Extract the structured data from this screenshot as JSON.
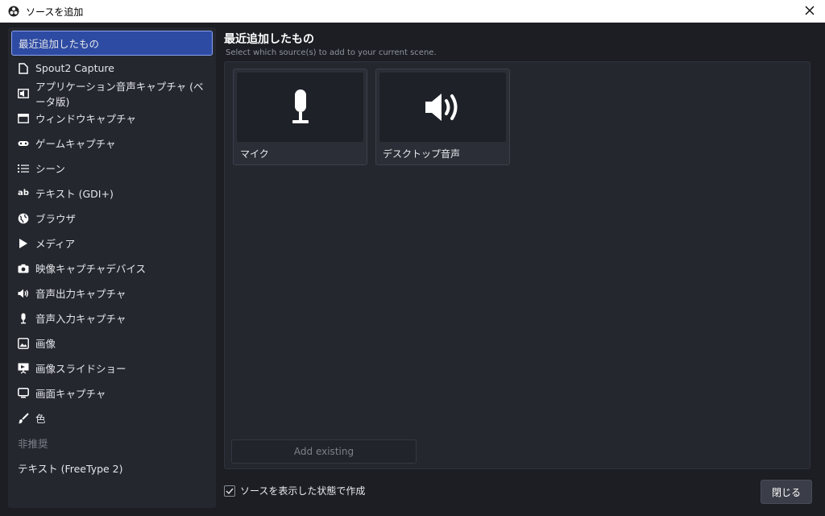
{
  "window": {
    "title": "ソースを追加"
  },
  "sidebar": {
    "items": [
      {
        "label": "最近追加したもの",
        "icon": ""
      },
      {
        "label": "Spout2 Capture",
        "icon": "file-icon"
      },
      {
        "label": "アプリケーション音声キャプチャ (ベータ版)",
        "icon": "app-audio-icon"
      },
      {
        "label": "ウィンドウキャプチャ",
        "icon": "window-icon"
      },
      {
        "label": "ゲームキャプチャ",
        "icon": "gamepad-icon"
      },
      {
        "label": "シーン",
        "icon": "list-icon"
      },
      {
        "label": "テキスト (GDI+)",
        "icon": "text-icon",
        "icon_text": "ab"
      },
      {
        "label": "ブラウザ",
        "icon": "globe-icon"
      },
      {
        "label": "メディア",
        "icon": "play-icon"
      },
      {
        "label": "映像キャプチャデバイス",
        "icon": "camera-icon"
      },
      {
        "label": "音声出力キャプチャ",
        "icon": "speaker-icon"
      },
      {
        "label": "音声入力キャプチャ",
        "icon": "microphone-icon"
      },
      {
        "label": "画像",
        "icon": "image-icon"
      },
      {
        "label": "画像スライドショー",
        "icon": "slideshow-icon"
      },
      {
        "label": "画面キャプチャ",
        "icon": "monitor-icon"
      },
      {
        "label": "色",
        "icon": "brush-icon"
      },
      {
        "label": "非推奨",
        "icon": ""
      },
      {
        "label": "テキスト (FreeType 2)",
        "icon": ""
      }
    ]
  },
  "main": {
    "title": "最近追加したもの",
    "subtitle": "Select which source(s) to add to your current scene.",
    "cards": [
      {
        "label": "マイク",
        "icon": "microphone-icon"
      },
      {
        "label": "デスクトップ音声",
        "icon": "speaker-icon"
      }
    ],
    "add_existing_label": "Add existing",
    "visible_checkbox_label": "ソースを表示した状態で作成",
    "visible_checked": true,
    "close_label": "閉じる"
  },
  "colors": {
    "accent": "#2e4ba3",
    "background": "#1c1e24",
    "panel": "#25272f"
  }
}
